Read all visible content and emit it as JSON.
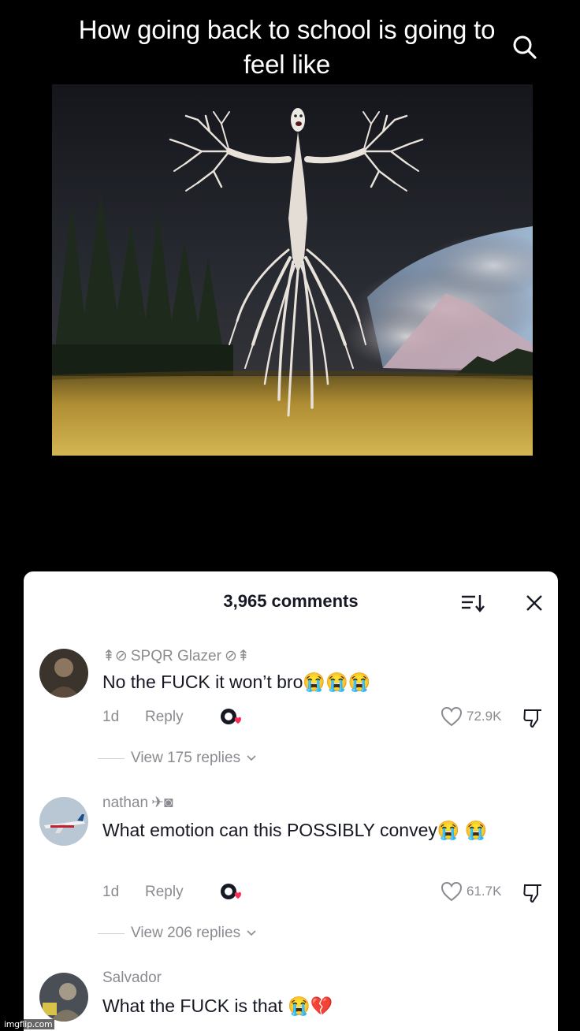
{
  "video": {
    "caption": "How going back to school is going to feel like"
  },
  "comments_panel": {
    "count_label": "3,965 comments",
    "comments": [
      {
        "username": "SPQR Glazer",
        "text": "No the FUCK it won’t bro😭😭😭",
        "time": "1d",
        "reply_label": "Reply",
        "likes": "72.9K",
        "view_replies": "View 175 replies"
      },
      {
        "username": "nathan",
        "text": "What emotion can this POSSIBLY convey😭 😭",
        "time": "1d",
        "reply_label": "Reply",
        "likes": "61.7K",
        "view_replies": "View 206 replies"
      },
      {
        "username": "Salvador",
        "text": "What the FUCK is that 😭💔"
      }
    ]
  },
  "watermark": "imgflip.com",
  "colors": {
    "background": "#000000",
    "sheet": "#ffffff",
    "text_primary": "#161823",
    "text_secondary": "#8a8b91",
    "like_heart_accent": "#fe2c55"
  }
}
